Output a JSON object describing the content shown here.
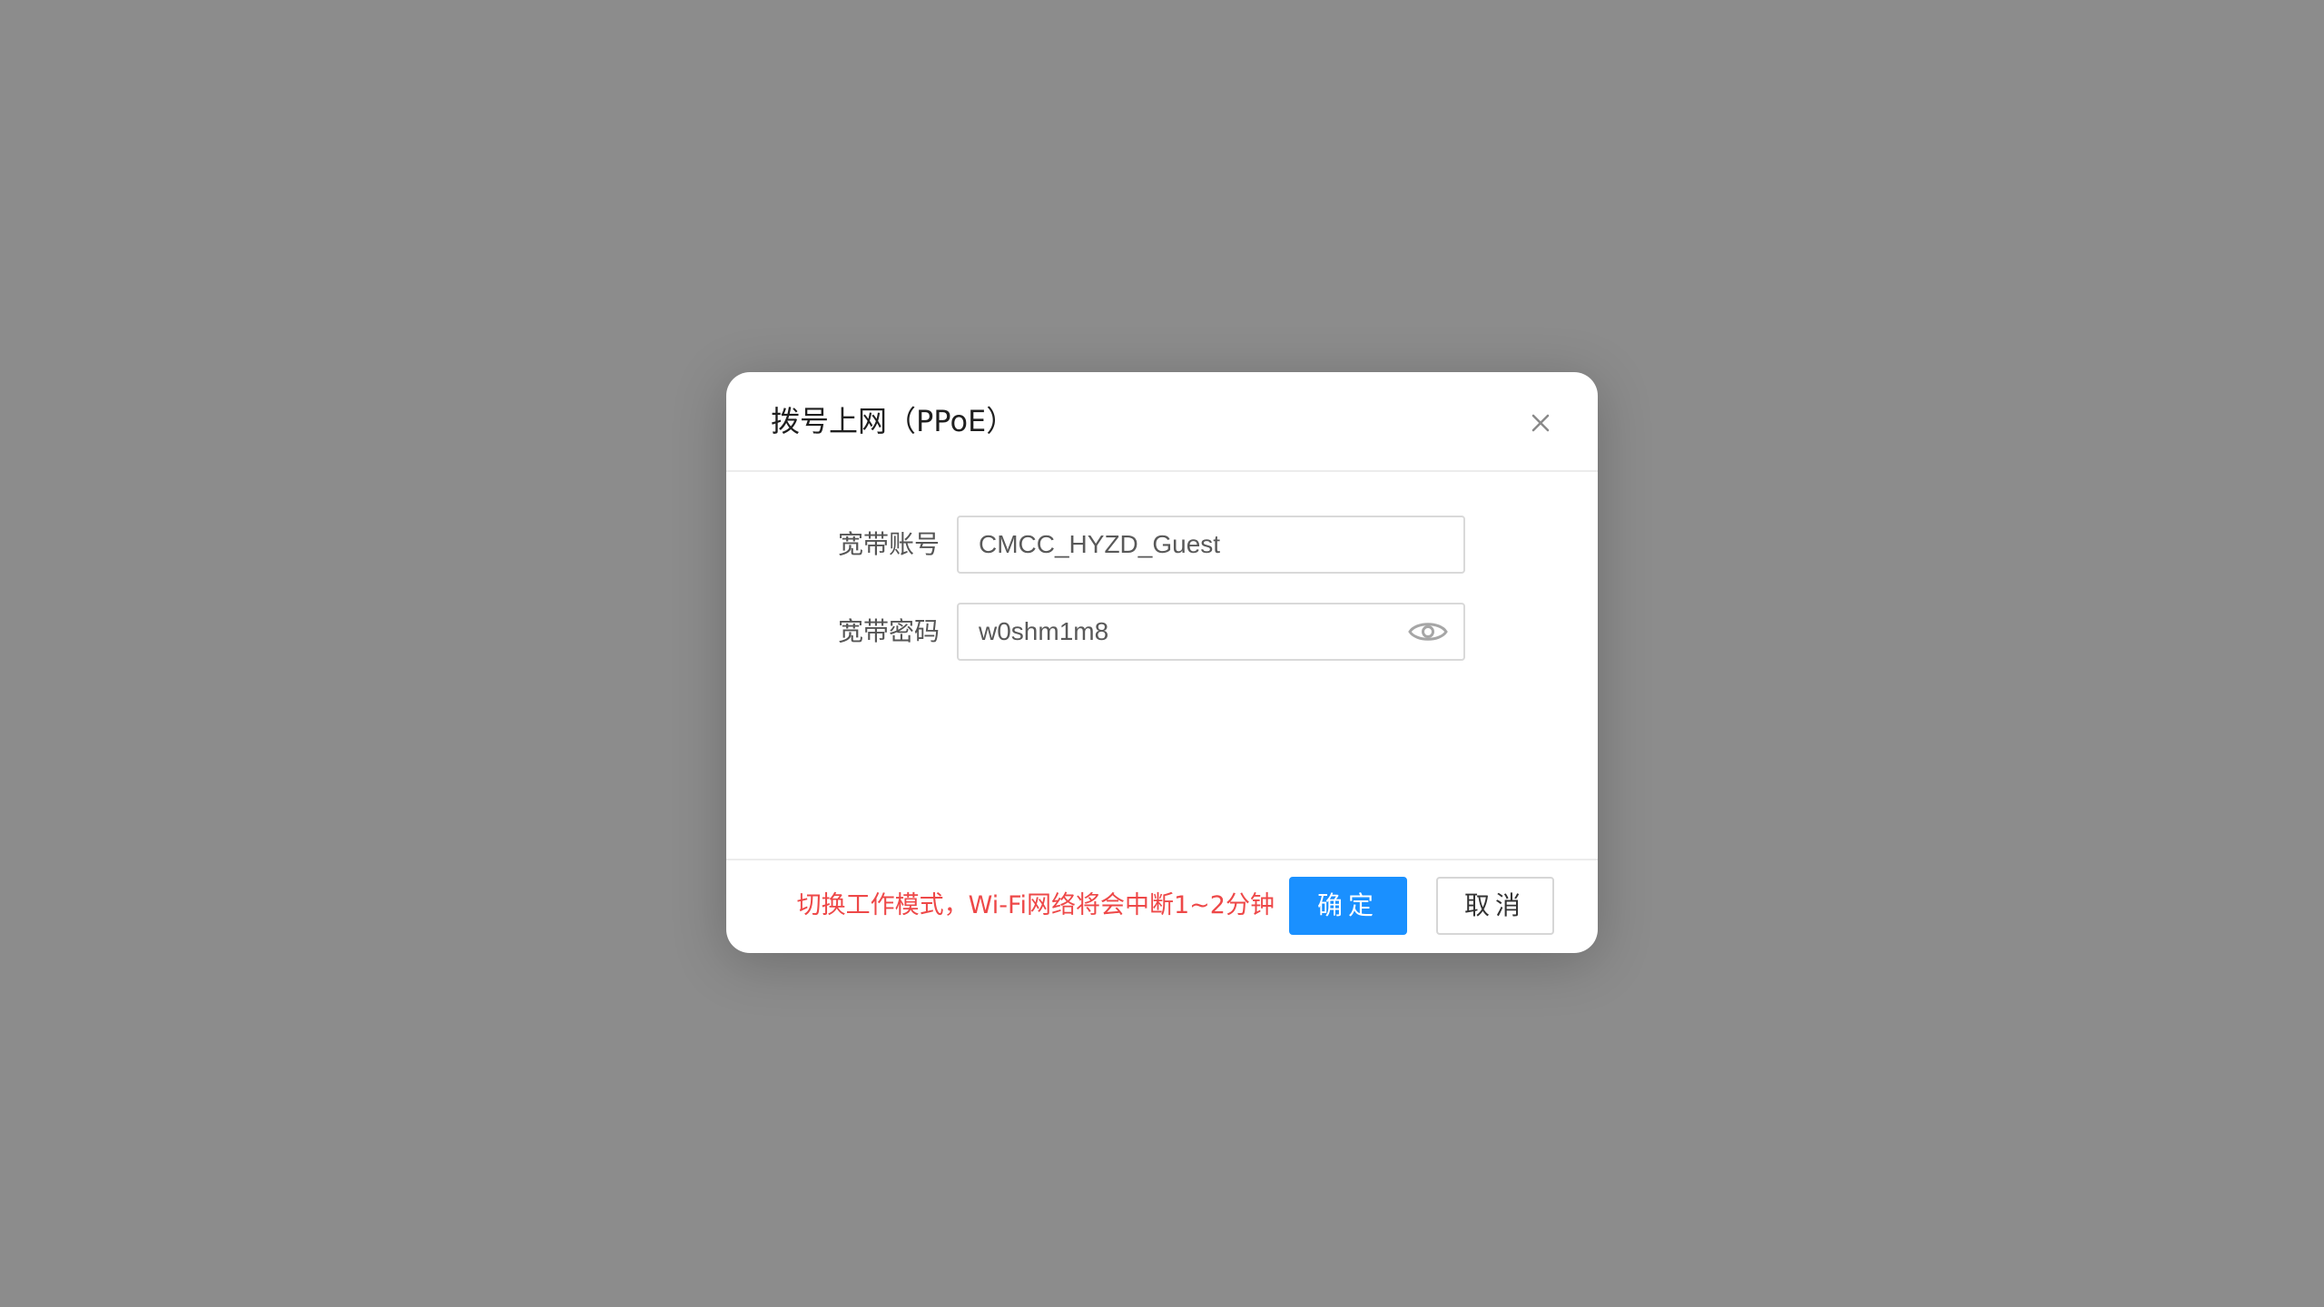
{
  "dialog": {
    "title": "拨号上网（PPoE）",
    "close_icon": "close-icon"
  },
  "form": {
    "account": {
      "label": "宽带账号",
      "value": "CMCC_HYZD_Guest"
    },
    "password": {
      "label": "宽带密码",
      "value": "w0shm1m8",
      "toggle_icon": "eye-icon"
    }
  },
  "footer": {
    "warning": "切换工作模式，Wi-Fi网络将会中断1~2分钟",
    "ok_label": "确定",
    "cancel_label": "取消"
  },
  "colors": {
    "overlay": "#8c8c8c",
    "primary": "#1a90ff",
    "warning": "#ee4848"
  }
}
